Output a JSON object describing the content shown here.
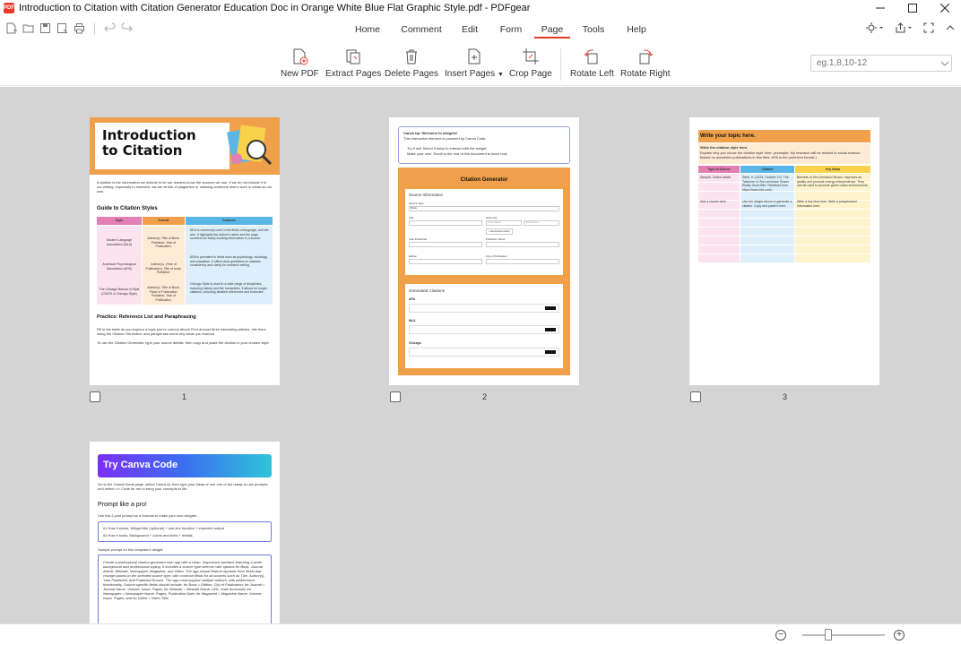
{
  "window": {
    "title": "Introduction to Citation with Citation Generator Education Doc in Orange White Blue Flat Graphic Style.pdf - PDFgear",
    "app_icon_text": "PDF"
  },
  "menu": {
    "tabs": [
      {
        "label": "Home"
      },
      {
        "label": "Comment"
      },
      {
        "label": "Edit"
      },
      {
        "label": "Form"
      },
      {
        "label": "Page",
        "active": true
      },
      {
        "label": "Tools"
      },
      {
        "label": "Help"
      }
    ]
  },
  "toolbar": {
    "new_pdf": "New PDF",
    "extract_pages": "Extract Pages",
    "delete_pages": "Delete Pages",
    "insert_pages": "Insert Pages",
    "crop_page": "Crop Page",
    "rotate_left": "Rotate Left",
    "rotate_right": "Rotate Right",
    "page_range_placeholder": "eg.1,8,10-12"
  },
  "pages": [
    {
      "number": "1"
    },
    {
      "number": "2"
    },
    {
      "number": "3"
    },
    {
      "number": "4"
    }
  ],
  "page1": {
    "title_line1": "Introduction",
    "title_line2": "to Citation",
    "intro": "A citation is the information we include to let our readers know the sources we use. If we do not include it in our writing, especially in research, we are at risk of plagiarism or claiming someone else's work or ideas as our own.",
    "guide_heading": "Guide to Citation Styles",
    "col_style": "Style",
    "col_format": "Format",
    "col_features": "Features",
    "row1_style": "Modern Language Association (MLA)",
    "row1_format": "Author(s). Title of Book. Publisher, Year of Publication.",
    "row1_features": "MLA is commonly used in the fields of language, and the arts. It highlights the author's name and the page numbers for easily locating information in a source.",
    "row2_style": "American Psychological Association (APA)",
    "row2_format": "Author(s). (Year of Publication). Title of book. Publisher.",
    "row2_features": "APA is prevalent in fields such as psychology, sociology, and education. It offers clear guidelines to maintain consistency and clarity for research writing.",
    "row3_style": "The Chicago Manual of Style (CMOS or Chicago Style)",
    "row3_format": "Author(s). Title of Book. Place of Publication: Publisher, Year of Publication.",
    "row3_features": "Chicago Style is used in a wide range of disciplines, including history and the humanities. It allows for longer citations, including detailed references and footnotes.",
    "practice_heading": "Practice: Reference List and Paraphrasing",
    "practice_text": "Fill in the table as you explore a topic you're curious about! Find at least three interesting articles, cite them using the Citation Generator, and paraphrase some key ideas you learned.",
    "practice_text2": "To use the Citation Generator, type your source details, then copy and paste the citation in your chosen style."
  },
  "page2": {
    "tip_title": "Canva tip: Welcome to widgets!",
    "tip_line": "This interactive element is powered by Canva Code.",
    "tip_b1": "Try it out! Select it twice to interact with the widget.",
    "tip_b2": "Make your own. Scroll to the end of this document to learn how.",
    "header": "Citation Generator",
    "source_info": "Source Information",
    "source_type_label": "Source Type",
    "source_type_value": "Book",
    "title_label": "Title",
    "authors_label": "Author(s)",
    "first_name": "First Name",
    "last_name": "Last Name",
    "add_author": "+ Add Another Author",
    "year_label": "Year Published",
    "publisher_label": "Publisher Name",
    "edition_label": "Edition",
    "city_label": "City of Publication",
    "generated": "Generated Citations",
    "apa": "APA",
    "mla": "MLA",
    "chicago": "Chicago"
  },
  "page3": {
    "header": "Write your topic here.",
    "instr1": "Write the citation style here.",
    "instr2": "Explain why you chose the citation style here. (example: My research will be related to social science. Based on academic publications in this field, APA is the preferred format.)",
    "col1": "Type of Source",
    "col2": "Citation",
    "col3": "Key Ideas",
    "r1c1": "Sample: Online article",
    "r1c2": "Steel, H. (2024, October 10). The Takeover of Zero-emission Buses Really Good Bite. Retrieved from https://www.bbc.com/...",
    "r1c3": "Benefits of Zero-Emission Buses: Improves air quality and promote energy independence. They can be used to promote green urban environments.",
    "r2c1": "Add a source here.",
    "r2c2": "Use the widget above to generate a citation. Copy and paste it here.",
    "r2c3": "Write a key idea here. Write a paraphrased information here."
  },
  "page4": {
    "banner": "Try Canva Code",
    "intro": "Go to the Canva Home page, select Canva AI, then type your ideas or use one of the ready-to-use prompts and select </> Code for me to bring your concepts to life.",
    "heading": "Prompt like a pro!",
    "sub": "Use this 2-part prompt as a formula to make your own widgets.",
    "box_l1": "#1 How it works: Widget title (optional) + one-line function + expected output",
    "box_l2": "#2 How it looks: Background + colors and fonts + details",
    "sample_label": "Sample prompt for this template's widget:",
    "sample_text": "Create a professional citation generator web app with a clean, responsive interface featuring a white background and professional styling. It includes a source type selector with options for Book, Journal Article, Website, Newspaper, Magazine, and Video. The app should feature dynamic form fields that change based on the selected source type, with common fields for all sources such as Title, Author(s), Year Published, and Publisher/Source. The app must support multiple authors, with add/remove functionality. Source-specific fields should include: for Book = Edition, City of Publication; for Journal = Journal Name, Volume, Issue, Pages; for Website = Website Name, URL, Date Accessed; for Newspaper = Newspaper Name, Pages, Publication Date; for Magazine = Magazine Name, Volume, Issue, Pages; and for Video = Video Title,"
  },
  "colors": {
    "accent": "#e8392b",
    "orange": "#f0a04b",
    "viewer_bg": "#d4d4d4"
  }
}
